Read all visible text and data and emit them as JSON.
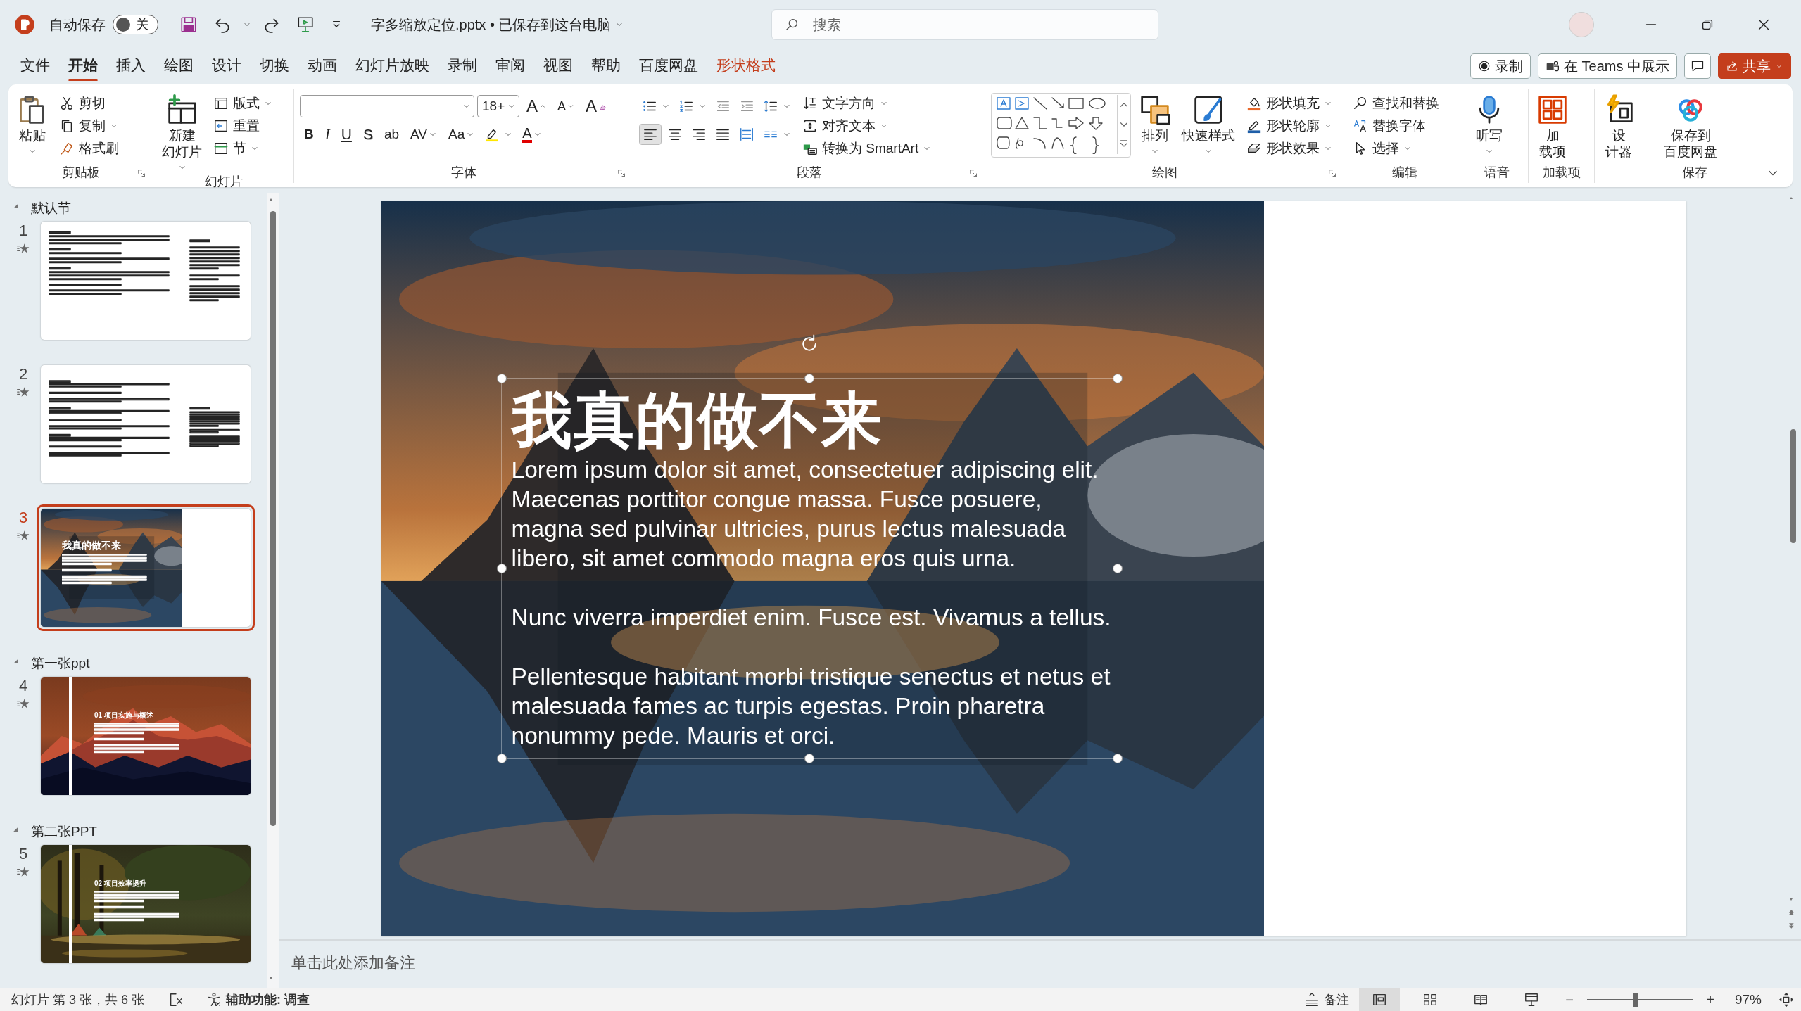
{
  "titlebar": {
    "autosave_label": "自动保存",
    "autosave": {
      "on": false,
      "state_label": "关"
    },
    "document_title": "字多缩放定位.pptx • 已保存到这台电脑",
    "search_placeholder": "搜索"
  },
  "menu_tabs": [
    {
      "label": "文件",
      "selected": false,
      "kind": "tab"
    },
    {
      "label": "开始",
      "selected": true,
      "kind": "tab"
    },
    {
      "label": "插入",
      "selected": false,
      "kind": "tab"
    },
    {
      "label": "绘图",
      "selected": false,
      "kind": "tab"
    },
    {
      "label": "设计",
      "selected": false,
      "kind": "tab"
    },
    {
      "label": "切换",
      "selected": false,
      "kind": "tab"
    },
    {
      "label": "动画",
      "selected": false,
      "kind": "tab"
    },
    {
      "label": "幻灯片放映",
      "selected": false,
      "kind": "tab"
    },
    {
      "label": "录制",
      "selected": false,
      "kind": "tab"
    },
    {
      "label": "审阅",
      "selected": false,
      "kind": "tab"
    },
    {
      "label": "视图",
      "selected": false,
      "kind": "tab"
    },
    {
      "label": "帮助",
      "selected": false,
      "kind": "tab"
    },
    {
      "label": "百度网盘",
      "selected": false,
      "kind": "tab"
    },
    {
      "label": "形状格式",
      "selected": false,
      "kind": "contextual"
    }
  ],
  "actions": [
    {
      "label": "录制",
      "kind": "record"
    },
    {
      "label": "在 Teams 中展示",
      "kind": "teams"
    },
    {
      "kind": "comments"
    },
    {
      "label": "共享",
      "kind": "share"
    }
  ],
  "ribbon": {
    "clipboard": {
      "label": "剪贴板",
      "paste": "粘贴",
      "cut": "剪切",
      "copy": "复制",
      "format_painter": "格式刷"
    },
    "slides": {
      "label": "幻灯片",
      "new_slide": [
        "新建",
        "幻灯片"
      ],
      "layout": "版式",
      "reset": "重置",
      "section": "节"
    },
    "font": {
      "label": "字体",
      "font_size": "18+",
      "size_tools": [
        "A",
        "A"
      ],
      "clear_format": "A",
      "format_buttons": [
        "B",
        "I",
        "U",
        "S",
        "ab",
        "AV",
        "Aa"
      ],
      "font_color": "A"
    },
    "paragraph": {
      "label": "段落",
      "text_direction": "文字方向",
      "align_text": "对齐文本",
      "smartart": "转换为 SmartArt"
    },
    "drawing": {
      "label": "绘图",
      "arrange": "排列",
      "quick_styles": "快速样式",
      "shape_fill": "形状填充",
      "shape_outline": "形状轮廓",
      "shape_effects": "形状效果"
    },
    "editing": {
      "label": "编辑",
      "find_replace": "查找和替换",
      "replace_fonts": "替换字体",
      "select": "选择"
    },
    "voice": {
      "label": "语音",
      "dictate": "听写"
    },
    "addins": {
      "label": "加载项",
      "button": [
        "加",
        "载项"
      ]
    },
    "designer": {
      "button": [
        "设",
        "计器"
      ]
    },
    "save": {
      "label": "保存",
      "button": [
        "保存到",
        "百度网盘"
      ]
    }
  },
  "slide_panel": {
    "sections": [
      {
        "name": "默认节",
        "expanded": true,
        "slides": [
          {
            "number": "1",
            "selected": false,
            "animated": true,
            "kind": "text"
          },
          {
            "number": "2",
            "selected": false,
            "animated": true,
            "kind": "text-dense"
          },
          {
            "number": "3",
            "selected": true,
            "animated": true,
            "kind": "photo-left",
            "title": "我真的做不来"
          }
        ]
      },
      {
        "name": "第一张ppt",
        "expanded": true,
        "slides": [
          {
            "number": "4",
            "selected": false,
            "animated": true,
            "kind": "photo-bar",
            "title": "01 项目实施与概述"
          }
        ]
      },
      {
        "name": "第二张PPT",
        "expanded": true,
        "slides": [
          {
            "number": "5",
            "selected": false,
            "animated": true,
            "kind": "photo-bar",
            "title": "02 项目效率提升"
          }
        ]
      }
    ]
  },
  "slide": {
    "title": "我真的做不来",
    "paragraphs": [
      "Lorem ipsum dolor sit amet, consectetuer adipiscing elit. Maecenas porttitor congue massa. Fusce posuere, magna sed pulvinar ultricies, purus lectus malesuada libero, sit amet commodo magna eros quis urna.",
      "Nunc viverra imperdiet enim. Fusce est. Vivamus a tellus.",
      "Pellentesque habitant morbi tristique senectus et netus et malesuada fames ac turpis egestas. Proin pharetra nonummy pede. Mauris et orci."
    ],
    "text_box_selected": true
  },
  "notes": {
    "placeholder": "单击此处添加备注"
  },
  "status": {
    "slide_position": "幻灯片 第 3 张，共 6 张",
    "accessibility": "辅助功能: 调查",
    "notes_button": "备注",
    "views": [
      {
        "kind": "normal",
        "selected": true
      },
      {
        "kind": "sorter",
        "selected": false
      },
      {
        "kind": "reading",
        "selected": false
      },
      {
        "kind": "show",
        "selected": false
      }
    ],
    "zoom": {
      "minus": "−",
      "plus": "+",
      "level": 0.46,
      "reading": "97%"
    }
  }
}
